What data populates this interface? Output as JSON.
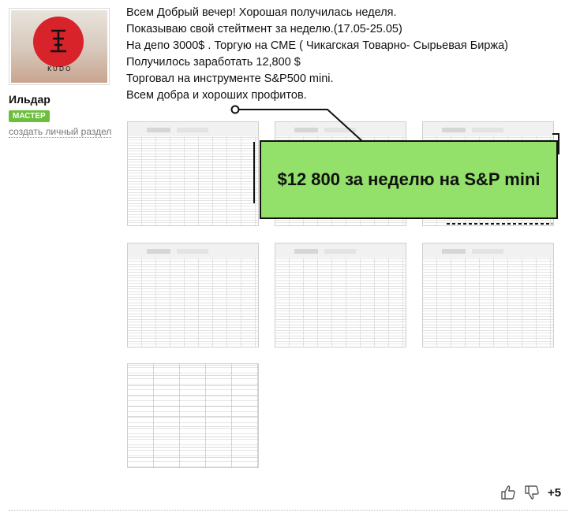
{
  "user": {
    "name": "Ильдар",
    "rank_badge": "МАСТЕР",
    "create_section_link": "создать личный раздел",
    "avatar_icon": "tattoo-photo-icon"
  },
  "message": {
    "lines": [
      " Всем Добрый вечер! Хорошая получилась неделя.",
      "Показываю свой стейтмент за неделю.(17.05-25.05)",
      "На депо 3000$ . Торгую на CME ( Чикагская Товарно- Сырьевая Биржа)",
      "Получилось заработать 12,800 $",
      "Торговал на инструменте S&P500 mini.",
      "Всем добра и хороших профитов."
    ]
  },
  "attachments": {
    "banner_text": "$12 800 за неделю на S&P mini",
    "items": [
      "statement-1",
      "statement-2",
      "statement-3",
      "statement-4",
      "statement-5",
      "statement-6",
      "statement-7"
    ]
  },
  "votes": {
    "score": "+5",
    "like_icon": "thumbs-up-icon",
    "dislike_icon": "thumbs-down-icon"
  }
}
